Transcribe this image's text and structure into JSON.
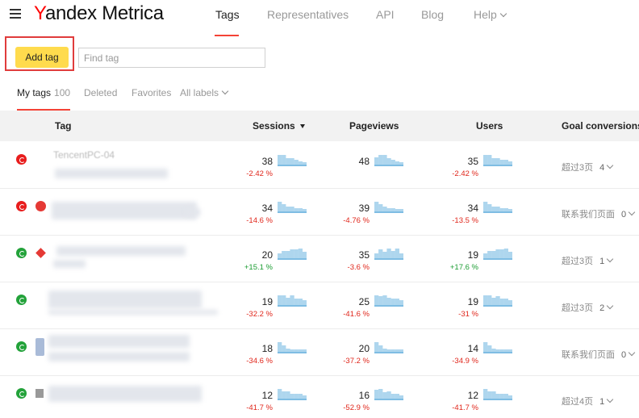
{
  "header": {
    "logo_y": "Y",
    "logo_rest": "andex Metrica",
    "nav": [
      {
        "label": "Tags",
        "active": true
      },
      {
        "label": "Representatives",
        "active": false
      },
      {
        "label": "API",
        "active": false
      },
      {
        "label": "Blog",
        "active": false
      },
      {
        "label": "Help",
        "active": false,
        "dropdown": true
      }
    ]
  },
  "toolbar": {
    "add_label": "Add tag",
    "search_placeholder": "Find tag",
    "search_value": ""
  },
  "filters": {
    "my_tags": "My tags",
    "my_tags_count": "100",
    "deleted": "Deleted",
    "favorites": "Favorites",
    "all_labels": "All labels"
  },
  "table": {
    "columns": {
      "tag": "Tag",
      "sessions": "Sessions",
      "pageviews": "Pageviews",
      "users": "Users",
      "goal": "Goal conversions"
    },
    "rows": [
      {
        "status": "red",
        "icon": "none",
        "name": "TencentPC-04",
        "sessions": "38",
        "sessions_pct": "-2.42 %",
        "sessions_sign": "neg",
        "pageviews": "48",
        "pageviews_pct": "",
        "pageviews_sign": "neg",
        "users": "35",
        "users_pct": "-2.42 %",
        "users_sign": "neg",
        "goal": "超过3页",
        "goal_count": "4",
        "spark_sessions": [
          0.9,
          0.9,
          0.6,
          0.6,
          0.5,
          0.4,
          0.3
        ],
        "spark_pageviews": [
          0.7,
          0.9,
          0.9,
          0.6,
          0.5,
          0.4,
          0.3
        ],
        "spark_users": [
          0.9,
          0.9,
          0.6,
          0.6,
          0.5,
          0.5,
          0.4
        ]
      },
      {
        "status": "red",
        "icon": "red-g",
        "name": "",
        "sessions": "34",
        "sessions_pct": "-14.6 %",
        "sessions_sign": "neg",
        "pageviews": "39",
        "pageviews_pct": "-4.76 %",
        "pageviews_sign": "neg",
        "users": "34",
        "users_pct": "-13.5 %",
        "users_sign": "neg",
        "goal": "联系我们页面",
        "goal_count": "0",
        "spark_sessions": [
          0.9,
          0.7,
          0.5,
          0.5,
          0.4,
          0.4,
          0.3
        ],
        "spark_pageviews": [
          0.9,
          0.7,
          0.5,
          0.4,
          0.4,
          0.3,
          0.3
        ],
        "spark_users": [
          0.9,
          0.7,
          0.5,
          0.5,
          0.4,
          0.4,
          0.3
        ]
      },
      {
        "status": "green",
        "icon": "diamond",
        "name": "",
        "sessions": "20",
        "sessions_pct": "+15.1 %",
        "sessions_sign": "pos",
        "pageviews": "35",
        "pageviews_pct": "-3.6 %",
        "pageviews_sign": "neg",
        "users": "19",
        "users_pct": "+17.6 %",
        "users_sign": "pos",
        "goal": "超过3页",
        "goal_count": "1",
        "spark_sessions": [
          0.5,
          0.7,
          0.7,
          0.8,
          0.8,
          0.9,
          0.6
        ],
        "spark_pageviews": [
          0.5,
          0.8,
          0.6,
          0.9,
          0.7,
          0.9,
          0.5
        ],
        "spark_users": [
          0.5,
          0.7,
          0.7,
          0.8,
          0.8,
          0.9,
          0.6
        ]
      },
      {
        "status": "green",
        "icon": "none",
        "name": "",
        "sessions": "19",
        "sessions_pct": "-32.2 %",
        "sessions_sign": "neg",
        "pageviews": "25",
        "pageviews_pct": "-41.6 %",
        "pageviews_sign": "neg",
        "users": "19",
        "users_pct": "-31 %",
        "users_sign": "neg",
        "goal": "超过3页",
        "goal_count": "2",
        "spark_sessions": [
          0.9,
          0.9,
          0.7,
          0.9,
          0.6,
          0.6,
          0.5
        ],
        "spark_pageviews": [
          0.9,
          0.8,
          0.9,
          0.7,
          0.6,
          0.6,
          0.5
        ],
        "spark_users": [
          0.9,
          0.9,
          0.7,
          0.8,
          0.6,
          0.6,
          0.5
        ]
      },
      {
        "status": "green",
        "icon": "blue",
        "name": "",
        "sessions": "18",
        "sessions_pct": "-34.6 %",
        "sessions_sign": "neg",
        "pageviews": "20",
        "pageviews_pct": "-37.2 %",
        "pageviews_sign": "neg",
        "users": "14",
        "users_pct": "-34.9 %",
        "users_sign": "neg",
        "goal": "联系我们页面",
        "goal_count": "0",
        "spark_sessions": [
          0.9,
          0.6,
          0.4,
          0.3,
          0.3,
          0.3,
          0.3
        ],
        "spark_pageviews": [
          0.9,
          0.6,
          0.4,
          0.3,
          0.3,
          0.3,
          0.3
        ],
        "spark_users": [
          0.9,
          0.6,
          0.4,
          0.3,
          0.3,
          0.3,
          0.3
        ]
      },
      {
        "status": "green",
        "icon": "grey",
        "name": "",
        "sessions": "12",
        "sessions_pct": "-41.7 %",
        "sessions_sign": "neg",
        "pageviews": "16",
        "pageviews_pct": "-52.9 %",
        "pageviews_sign": "neg",
        "users": "12",
        "users_pct": "-41.7 %",
        "users_sign": "neg",
        "goal": "超过4页",
        "goal_count": "1",
        "spark_sessions": [
          0.9,
          0.7,
          0.7,
          0.5,
          0.5,
          0.5,
          0.4
        ],
        "spark_pageviews": [
          0.8,
          0.9,
          0.6,
          0.7,
          0.5,
          0.5,
          0.4
        ],
        "spark_users": [
          0.9,
          0.7,
          0.7,
          0.5,
          0.5,
          0.5,
          0.4
        ]
      }
    ]
  },
  "colors": {
    "accent_red": "#f44336",
    "button_yellow": "#ffdb4d",
    "negative": "#e0261b",
    "positive": "#1b9c32",
    "sparkline": "#aed6ee"
  }
}
